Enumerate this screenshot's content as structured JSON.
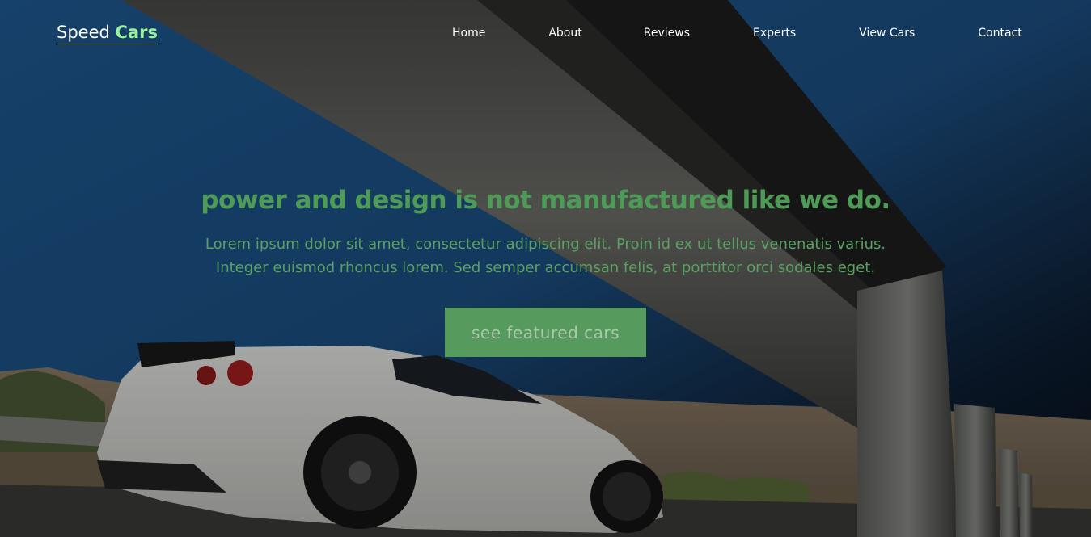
{
  "theme": {
    "accent": "#4e9a57",
    "accent_text": "#5aa163",
    "button_bg": "#579a5e",
    "button_text": "#a9c9ab"
  },
  "brand": {
    "name_part1": "Speed ",
    "name_part2": "Cars",
    "accent_color": "#9af29c"
  },
  "nav": {
    "items": [
      {
        "label": "Home"
      },
      {
        "label": "About"
      },
      {
        "label": "Reviews"
      },
      {
        "label": "Experts"
      },
      {
        "label": "View Cars"
      },
      {
        "label": "Contact"
      }
    ]
  },
  "hero": {
    "headline": "power and design is not manufactured like we do.",
    "subline1": "Lorem ipsum dolor sit amet, consectetur adipiscing elit. Proin id ex ut tellus venenatis varius.",
    "subline2": "Integer euismod rhoncus lorem. Sed semper accumsan felis, at porttitor orci sodales eget.",
    "cta_label": "see featured cars",
    "background_image": "white-sports-car-under-guardrail"
  }
}
